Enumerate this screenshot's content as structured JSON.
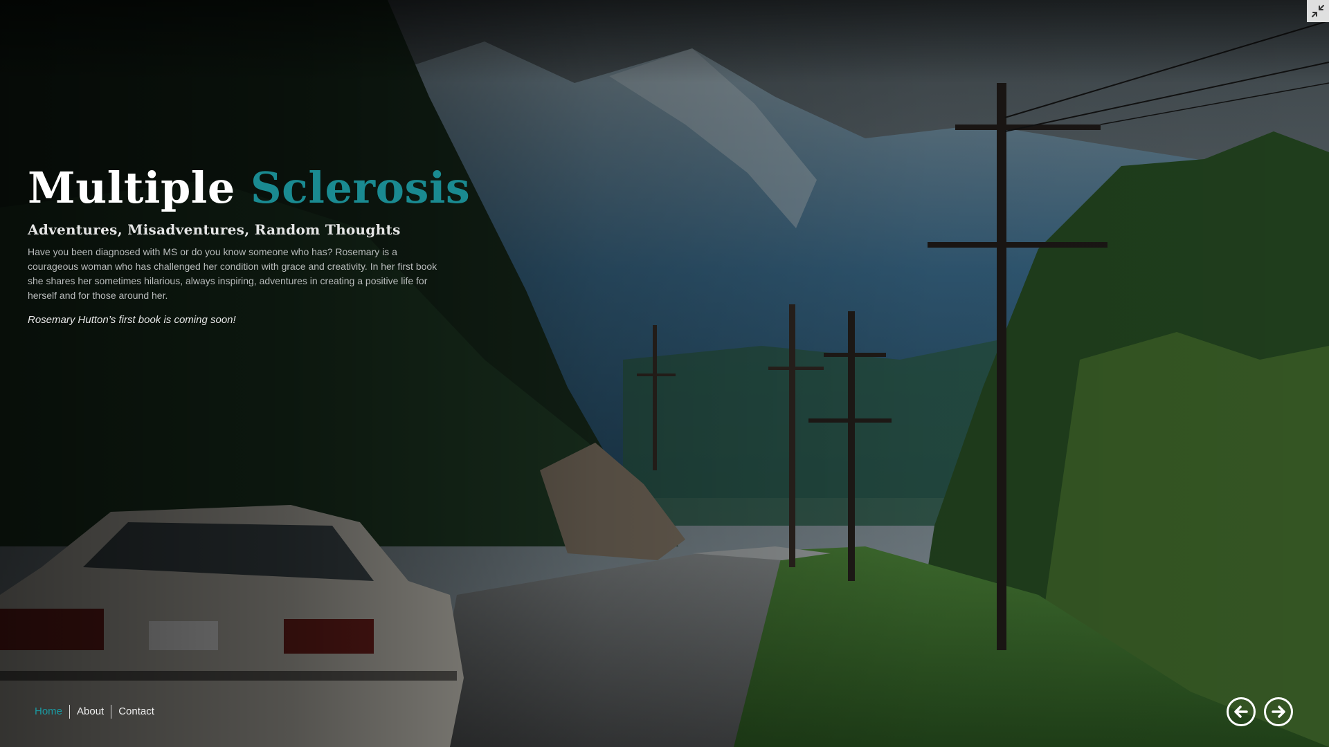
{
  "hero": {
    "title_main": "Multiple",
    "title_accent": "Sclerosis",
    "subtitle": "Adventures, Misadventures, Random Thoughts",
    "description": "Have you been diagnosed with MS or do you know someone who has? Rosemary is a courageous woman who has challenged her condition with grace and creativity. In her first book she shares her sometimes hilarious, always inspiring, adventures in creating a positive life for herself and for those around her.",
    "teaser": "Rosemary Hutton’s first book is coming soon!"
  },
  "nav": {
    "items": [
      {
        "label": "Home",
        "active": true
      },
      {
        "label": "About",
        "active": false
      },
      {
        "label": "Contact",
        "active": false
      }
    ]
  },
  "controls": {
    "prev_icon": "arrow-left-circle-icon",
    "next_icon": "arrow-right-circle-icon",
    "fullscreen_icon": "exit-fullscreen-icon"
  },
  "colors": {
    "accent": "#1a8a91",
    "nav_active": "#1a9aa2",
    "text": "#ffffff"
  }
}
